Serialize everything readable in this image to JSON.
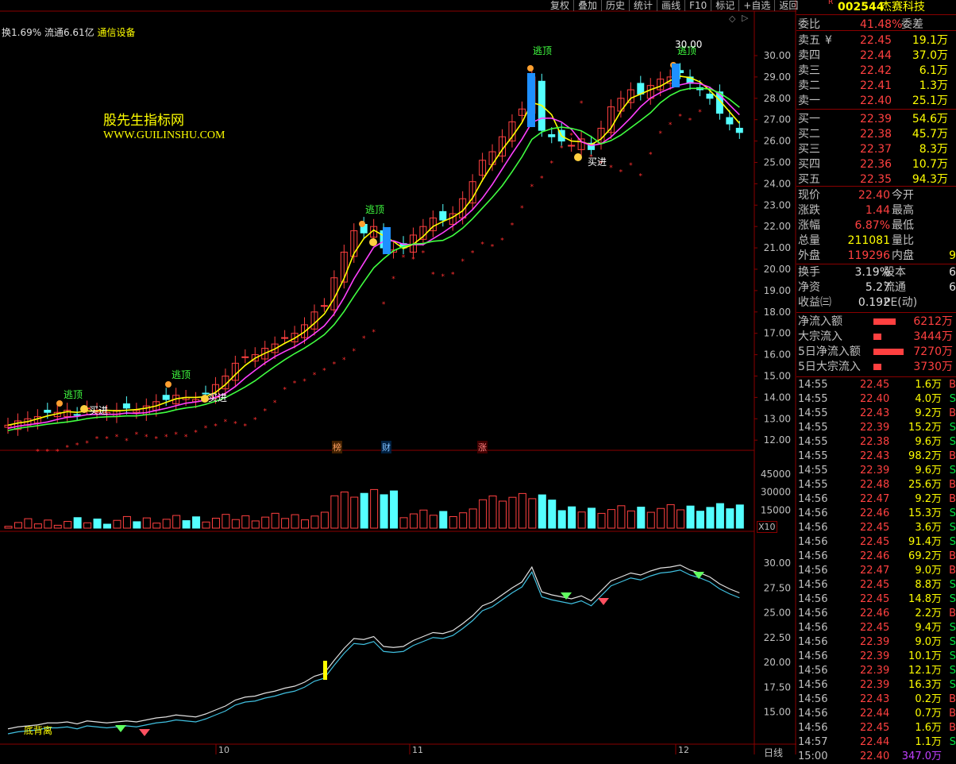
{
  "toolbar": [
    "复权",
    "叠加",
    "历史",
    "统计",
    "画线",
    "F10",
    "标记",
    "+自选",
    "返回"
  ],
  "info_line": {
    "turnover": "换1.69%",
    "float": "流通6.61亿",
    "industry": "通信设备"
  },
  "watermark": {
    "cn": "股先生指标网",
    "url": "WWW.GUILINSHU.COM"
  },
  "price_axis": [
    "30.00",
    "29.00",
    "28.00",
    "27.00",
    "26.00",
    "25.00",
    "24.00",
    "23.00",
    "22.00",
    "21.00",
    "20.00",
    "19.00",
    "18.00",
    "17.00",
    "16.00",
    "15.00",
    "14.00",
    "13.00",
    "12.00"
  ],
  "vol_axis": [
    "45000",
    "30000",
    "15000"
  ],
  "vol_unit": "X10",
  "ind_axis": [
    "30.00",
    "27.50",
    "25.00",
    "22.50",
    "20.00",
    "17.50",
    "15.00"
  ],
  "date_axis": [
    "10",
    "11",
    "12"
  ],
  "chart_tags": {
    "bang": "榜",
    "cai": "财",
    "zhang": "涨"
  },
  "signals": {
    "top": "逃顶",
    "buy": "买进",
    "peak_label": "30.00",
    "div": "底背离"
  },
  "bottom_label": "日线",
  "colors": {
    "up": "#ff4040",
    "down": "#54ffff",
    "ma_fast": "#ffff00",
    "ma_mid": "#ff40ff",
    "ma_slow": "#40ff40",
    "bg": "#000000",
    "grid": "#8a0000"
  },
  "stock": {
    "code": "002544",
    "name": "杰赛科技",
    "r_mark": "R"
  },
  "weibi": {
    "label1": "委比",
    "val1": "41.48%",
    "label2": "委差"
  },
  "sell": [
    {
      "label": "卖五",
      "price": "22.45",
      "vol": "19.1万",
      "mark": "¥"
    },
    {
      "label": "卖四",
      "price": "22.44",
      "vol": "37.0万"
    },
    {
      "label": "卖三",
      "price": "22.42",
      "vol": "6.1万"
    },
    {
      "label": "卖二",
      "price": "22.41",
      "vol": "1.3万"
    },
    {
      "label": "卖一",
      "price": "22.40",
      "vol": "25.1万"
    }
  ],
  "buy": [
    {
      "label": "买一",
      "price": "22.39",
      "vol": "54.6万"
    },
    {
      "label": "买二",
      "price": "22.38",
      "vol": "45.7万"
    },
    {
      "label": "买三",
      "price": "22.37",
      "vol": "8.3万"
    },
    {
      "label": "买四",
      "price": "22.36",
      "vol": "10.7万"
    },
    {
      "label": "买五",
      "price": "22.35",
      "vol": "94.3万"
    }
  ],
  "quote": [
    {
      "l": "现价",
      "v": "22.40",
      "l2": "今开",
      "v2": ""
    },
    {
      "l": "涨跌",
      "v": "1.44",
      "l2": "最高",
      "v2": ""
    },
    {
      "l": "涨幅",
      "v": "6.87%",
      "l2": "最低",
      "v2": ""
    },
    {
      "l": "总量",
      "v": "211081",
      "l2": "量比",
      "v2": ""
    },
    {
      "l": "外盘",
      "v": "119296",
      "l2": "内盘",
      "v2": "9"
    }
  ],
  "fund": [
    {
      "l": "换手",
      "v": "3.19%",
      "l2": "股本",
      "v2": "6"
    },
    {
      "l": "净资",
      "v": "5.27",
      "l2": "流通",
      "v2": "6"
    },
    {
      "l": "收益㈢",
      "v": "0.192",
      "l2": "PE(动)",
      "v2": ""
    }
  ],
  "flows": [
    {
      "l": "净流入额",
      "v": "6212万"
    },
    {
      "l": "大宗流入",
      "v": "3444万"
    },
    {
      "l": "5日净流入额",
      "v": "7270万"
    },
    {
      "l": "5日大宗流入",
      "v": "3730万"
    }
  ],
  "trades": [
    [
      "14:55",
      "22.45",
      "1.6万",
      "B"
    ],
    [
      "14:55",
      "22.40",
      "4.0万",
      "S"
    ],
    [
      "14:55",
      "22.43",
      "9.2万",
      "B"
    ],
    [
      "14:55",
      "22.39",
      "15.2万",
      "S"
    ],
    [
      "14:55",
      "22.38",
      "9.6万",
      "S"
    ],
    [
      "14:55",
      "22.43",
      "98.2万",
      "B"
    ],
    [
      "14:55",
      "22.39",
      "9.6万",
      "S"
    ],
    [
      "14:55",
      "22.48",
      "25.6万",
      "B"
    ],
    [
      "14:56",
      "22.47",
      "9.2万",
      "B"
    ],
    [
      "14:56",
      "22.46",
      "15.3万",
      "S"
    ],
    [
      "14:56",
      "22.45",
      "3.6万",
      "S"
    ],
    [
      "14:56",
      "22.45",
      "91.4万",
      "S"
    ],
    [
      "14:56",
      "22.46",
      "69.2万",
      "B"
    ],
    [
      "14:56",
      "22.47",
      "9.0万",
      "B"
    ],
    [
      "14:56",
      "22.45",
      "8.8万",
      "S"
    ],
    [
      "14:56",
      "22.45",
      "14.8万",
      "S"
    ],
    [
      "14:56",
      "22.46",
      "2.2万",
      "B"
    ],
    [
      "14:56",
      "22.45",
      "9.4万",
      "S"
    ],
    [
      "14:56",
      "22.39",
      "9.0万",
      "S"
    ],
    [
      "14:56",
      "22.39",
      "10.1万",
      "S"
    ],
    [
      "14:56",
      "22.39",
      "12.1万",
      "S"
    ],
    [
      "14:56",
      "22.39",
      "16.3万",
      "S"
    ],
    [
      "14:56",
      "22.43",
      "0.2万",
      "B"
    ],
    [
      "14:56",
      "22.44",
      "0.7万",
      "B"
    ],
    [
      "14:56",
      "22.45",
      "1.6万",
      "B"
    ],
    [
      "14:57",
      "22.44",
      "1.1万",
      "S"
    ]
  ],
  "last_trade": {
    "t": "15:00",
    "p": "22.40",
    "v": "347.0万"
  }
}
